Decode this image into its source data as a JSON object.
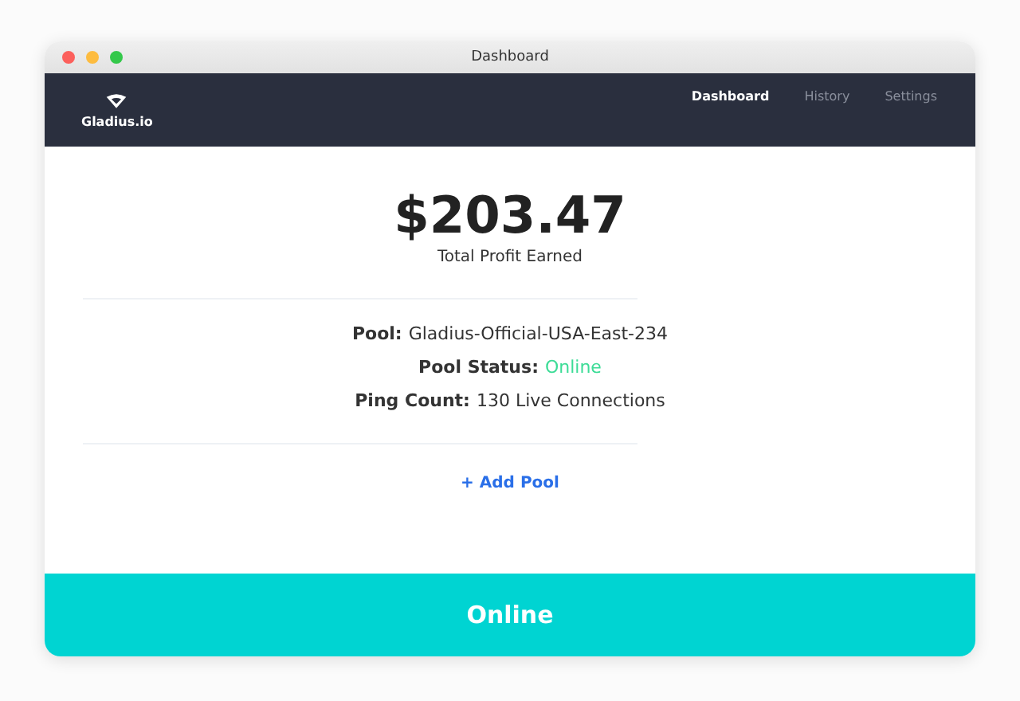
{
  "window": {
    "title": "Dashboard"
  },
  "brand": {
    "name": "Gladius.io"
  },
  "tabs": [
    {
      "label": "Dashboard",
      "selected": true
    },
    {
      "label": "History",
      "selected": false
    },
    {
      "label": "Settings",
      "selected": false
    }
  ],
  "profit": {
    "amount": "$203.47",
    "caption": "Total Profit Earned"
  },
  "details": [
    {
      "label": "Pool:",
      "value": "Gladius-Official-USA-East-234",
      "kind": "plain"
    },
    {
      "label": "Pool Status:",
      "value": "Online",
      "kind": "status"
    },
    {
      "label": "Ping Count:",
      "value": "130 Live Connections",
      "kind": "plain"
    }
  ],
  "add_pool": {
    "label": "+ Add Pool"
  },
  "status_bar": {
    "label": "Online"
  }
}
